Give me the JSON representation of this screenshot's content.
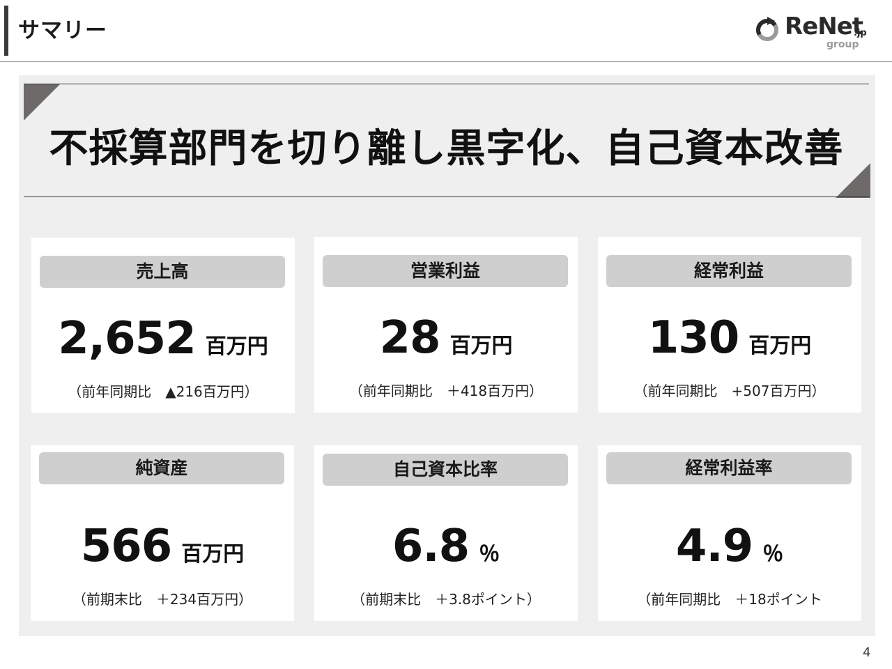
{
  "header": {
    "title": "サマリー",
    "logo": {
      "word": "ReNet",
      "tld": ".jp",
      "sub": "group"
    }
  },
  "banner": {
    "headline": "不採算部門を切り離し黒字化、自己資本改善"
  },
  "cards": [
    {
      "label": "売上高",
      "value": "2,652",
      "unit": "百万円",
      "note": "（前年同期比　▲216百万円）"
    },
    {
      "label": "営業利益",
      "value": "28",
      "unit": "百万円",
      "note": "（前年同期比　＋418百万円）"
    },
    {
      "label": "経常利益",
      "value": "130",
      "unit": "百万円",
      "note": "（前年同期比　+507百万円）"
    },
    {
      "label": "純資産",
      "value": "566",
      "unit": "百万円",
      "note": "（前期末比　＋234百万円）"
    },
    {
      "label": "自己資本比率",
      "value": "6.8",
      "unit": "％",
      "note": "（前期末比　＋3.8ポイント）"
    },
    {
      "label": "経常利益率",
      "value": "4.9",
      "unit": "％",
      "note": "（前年同期比　＋18ポイント"
    }
  ],
  "footer": {
    "page_number": "4"
  },
  "colors": {
    "panel_bg": "#efefef",
    "label_bg": "#d0cfd0",
    "corner_triangle": "#6e6a6a",
    "text": "#111111"
  }
}
